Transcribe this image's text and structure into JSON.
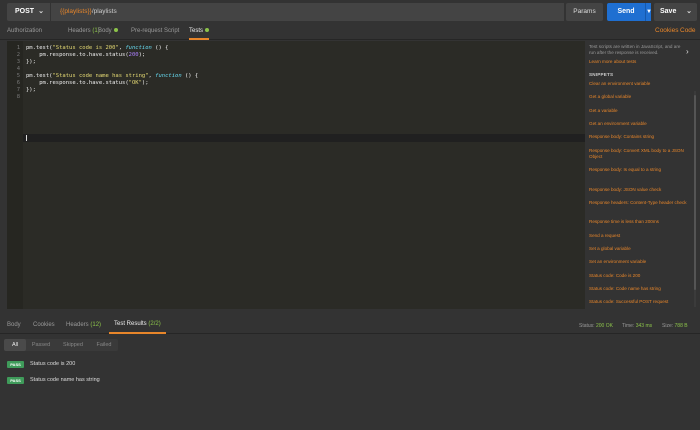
{
  "request": {
    "method": "POST",
    "url_var": "{{playlists}}",
    "url_path": "/playlists",
    "params_label": "Params",
    "send_label": "Send",
    "save_label": "Save"
  },
  "req_tabs": {
    "authorization": "Authorization",
    "headers": "Headers",
    "headers_count": "(1)",
    "body": "Body",
    "prerequest": "Pre-request Script",
    "tests": "Tests",
    "cookies": "Cookies",
    "code": "Code"
  },
  "editor": {
    "line_numbers": [
      "1",
      "2",
      "3",
      "4",
      "5",
      "6",
      "7",
      "8"
    ],
    "lines": [
      [
        {
          "t": "pm.test(",
          "c": ""
        },
        {
          "t": "\"Status code is 200\"",
          "c": "str"
        },
        {
          "t": ", ",
          "c": ""
        },
        {
          "t": "function",
          "c": "kw"
        },
        {
          "t": " () {",
          "c": ""
        }
      ],
      [
        {
          "t": "    pm.response.to.have.status(",
          "c": ""
        },
        {
          "t": "200",
          "c": "num"
        },
        {
          "t": ");",
          "c": ""
        }
      ],
      [
        {
          "t": "});",
          "c": ""
        }
      ],
      [
        {
          "t": "",
          "c": ""
        }
      ],
      [
        {
          "t": "pm.test(",
          "c": ""
        },
        {
          "t": "\"Status code name has string\"",
          "c": "str"
        },
        {
          "t": ", ",
          "c": ""
        },
        {
          "t": "function",
          "c": "kw"
        },
        {
          "t": " () {",
          "c": ""
        }
      ],
      [
        {
          "t": "    pm.response.to.have.status(",
          "c": ""
        },
        {
          "t": "\"OK\"",
          "c": "str"
        },
        {
          "t": ");",
          "c": ""
        }
      ],
      [
        {
          "t": "});",
          "c": ""
        }
      ],
      [
        {
          "t": "",
          "c": ""
        }
      ]
    ]
  },
  "sidebar": {
    "intro": "Test scripts are written in JavaScript, and are run after the response is received.",
    "learn_more": "Learn more about tests",
    "snippets_heading": "SNIPPETS",
    "snippets": [
      "Clear an environment variable",
      "Get a global variable",
      "Get a variable",
      "Get an environment variable",
      "Response body: Contains string",
      "Response body: Convert XML body to a JSON Object",
      "Response body: Is equal to a string",
      "Response body: JSON value check",
      "Response headers: Content-Type header check",
      "Response time is less than 200ms",
      "Send a request",
      "Set a global variable",
      "Set an environment variable",
      "Status code: Code is 200",
      "Status code: Code name has string",
      "Status code: Successful POST request",
      "Use Tiny Validator for JSON data"
    ]
  },
  "response": {
    "tabs": {
      "body": "Body",
      "cookies": "Cookies",
      "headers": "Headers",
      "headers_count": "(12)",
      "test_results": "Test Results",
      "test_results_count": "(2/2)"
    },
    "status_label": "Status:",
    "status_value": "200 OK",
    "time_label": "Time:",
    "time_value": "343 ms",
    "size_label": "Size:",
    "size_value": "788 B",
    "filters": [
      "All",
      "Passed",
      "Skipped",
      "Failed"
    ],
    "results": [
      {
        "badge": "PASS",
        "name": "Status code is 200"
      },
      {
        "badge": "PASS",
        "name": "Status code name has string"
      }
    ]
  },
  "colors": {
    "accent": "#e8862a",
    "send_blue": "#1f6fd1",
    "pass_green": "#3f9b5a",
    "count_green": "#8cc34a"
  }
}
